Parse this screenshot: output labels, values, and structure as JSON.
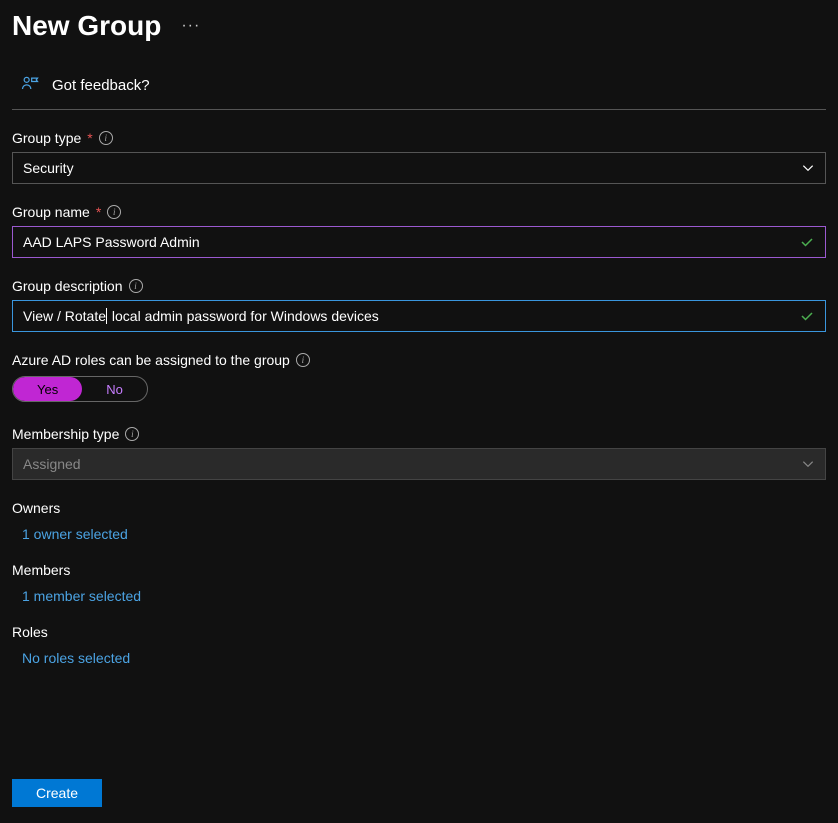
{
  "header": {
    "title": "New Group"
  },
  "feedback": {
    "text": "Got feedback?"
  },
  "fields": {
    "groupType": {
      "label": "Group type",
      "value": "Security"
    },
    "groupName": {
      "label": "Group name",
      "value": "AAD LAPS Password Admin"
    },
    "groupDescription": {
      "label": "Group description",
      "valuePrefix": "View / Rotate",
      "valueSuffix": " local admin password for Windows devices"
    },
    "rolesAssignable": {
      "label": "Azure AD roles can be assigned to the group",
      "toggle": {
        "yes": "Yes",
        "no": "No"
      }
    },
    "membershipType": {
      "label": "Membership type",
      "value": "Assigned"
    }
  },
  "sections": {
    "owners": {
      "title": "Owners",
      "link": "1 owner selected"
    },
    "members": {
      "title": "Members",
      "link": "1 member selected"
    },
    "roles": {
      "title": "Roles",
      "link": "No roles selected"
    }
  },
  "footer": {
    "create": "Create"
  }
}
